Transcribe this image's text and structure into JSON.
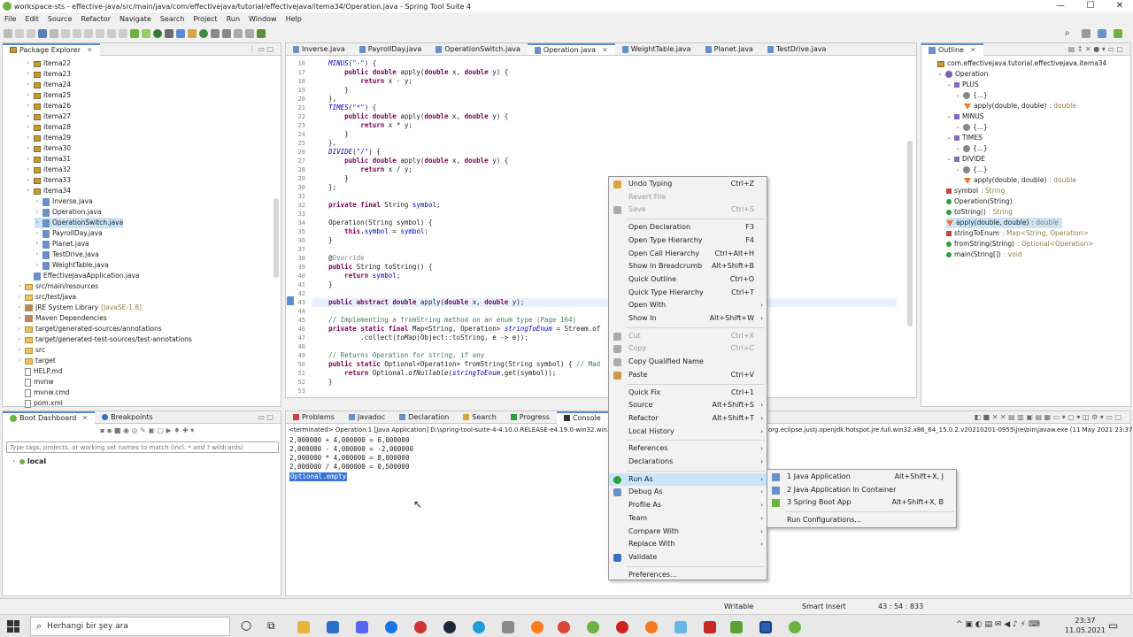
{
  "window": {
    "title": "workspace-sts - effective-java/src/main/java/com/effectivejava/tutorial/effectivejava/itema34/Operation.java - Spring Tool Suite 4",
    "minimize": "—",
    "maximize": "☐",
    "close": "✕"
  },
  "menubar": [
    "File",
    "Edit",
    "Source",
    "Refactor",
    "Navigate",
    "Search",
    "Project",
    "Run",
    "Window",
    "Help"
  ],
  "package_explorer": {
    "tab": "Package Explorer",
    "items": [
      {
        "label": "itema22",
        "type": "pkg",
        "indent": 2
      },
      {
        "label": "itema23",
        "type": "pkg",
        "indent": 2
      },
      {
        "label": "itema24",
        "type": "pkg",
        "indent": 2
      },
      {
        "label": "itema25",
        "type": "pkg",
        "indent": 2
      },
      {
        "label": "itema26",
        "type": "pkg",
        "indent": 2
      },
      {
        "label": "itema27",
        "type": "pkg",
        "indent": 2
      },
      {
        "label": "itema28",
        "type": "pkg",
        "indent": 2
      },
      {
        "label": "itema29",
        "type": "pkg",
        "indent": 2
      },
      {
        "label": "itema30",
        "type": "pkg",
        "indent": 2
      },
      {
        "label": "itema31",
        "type": "pkg",
        "indent": 2
      },
      {
        "label": "itema32",
        "type": "pkg",
        "indent": 2
      },
      {
        "label": "itema33",
        "type": "pkg",
        "indent": 2
      },
      {
        "label": "itema34",
        "type": "pkg",
        "indent": 2
      },
      {
        "label": "Inverse.java",
        "type": "java",
        "indent": 3
      },
      {
        "label": "Operation.java",
        "type": "java",
        "indent": 3
      },
      {
        "label": "OperationSwitch.java",
        "type": "java",
        "indent": 3
      },
      {
        "label": "PayrollDay.java",
        "type": "java",
        "indent": 3
      },
      {
        "label": "Planet.java",
        "type": "java",
        "indent": 3
      },
      {
        "label": "TestDrive.java",
        "type": "java",
        "indent": 3
      },
      {
        "label": "WeightTable.java",
        "type": "java",
        "indent": 3
      },
      {
        "label": "EffectiveJavaApplication.java",
        "type": "java",
        "indent": 2
      },
      {
        "label": "src/main/resources",
        "type": "folder",
        "indent": 1
      },
      {
        "label": "src/test/java",
        "type": "folder",
        "indent": 1
      },
      {
        "label": "JRE System Library",
        "suffix": "[JavaSE-1.8]",
        "type": "lib",
        "indent": 1
      },
      {
        "label": "Maven Dependencies",
        "type": "lib",
        "indent": 1
      },
      {
        "label": "target/generated-sources/annotations",
        "type": "folder",
        "indent": 1
      },
      {
        "label": "target/generated-test-sources/test-annotations",
        "type": "folder",
        "indent": 1
      },
      {
        "label": "src",
        "type": "folder",
        "indent": 1
      },
      {
        "label": "target",
        "type": "folder",
        "indent": 1
      },
      {
        "label": "HELP.md",
        "type": "file",
        "indent": 1
      },
      {
        "label": "mvnw",
        "type": "file",
        "indent": 1
      },
      {
        "label": "mvnw.cmd",
        "type": "file",
        "indent": 1
      },
      {
        "label": "pom.xml",
        "type": "file",
        "indent": 1
      }
    ]
  },
  "editor_tabs": [
    "Inverse.java",
    "PayrollDay.java",
    "OperationSwitch.java",
    "Operation.java",
    "WeightTable.java",
    "Planet.java",
    "TestDrive.java"
  ],
  "code_lines": [
    {
      "n": "16",
      "t": "    MINUS(\"-\") {"
    },
    {
      "n": "17",
      "t": "        public double apply(double x, double y) {"
    },
    {
      "n": "18",
      "t": "            return x - y;"
    },
    {
      "n": "19",
      "t": "        }"
    },
    {
      "n": "20",
      "t": "    },"
    },
    {
      "n": "21",
      "t": "    TIMES(\"*\") {"
    },
    {
      "n": "22",
      "t": "        public double apply(double x, double y) {"
    },
    {
      "n": "23",
      "t": "            return x * y;"
    },
    {
      "n": "24",
      "t": "        }"
    },
    {
      "n": "25",
      "t": "    },"
    },
    {
      "n": "26",
      "t": "    DIVIDE(\"/\") {"
    },
    {
      "n": "27",
      "t": "        public double apply(double x, double y) {"
    },
    {
      "n": "28",
      "t": "            return x / y;"
    },
    {
      "n": "29",
      "t": "        }"
    },
    {
      "n": "30",
      "t": "    };"
    },
    {
      "n": "31",
      "t": ""
    },
    {
      "n": "32",
      "t": "    private final String symbol;"
    },
    {
      "n": "33",
      "t": ""
    },
    {
      "n": "34",
      "t": "    Operation(String symbol) {"
    },
    {
      "n": "35",
      "t": "        this.symbol = symbol;"
    },
    {
      "n": "36",
      "t": "    }"
    },
    {
      "n": "37",
      "t": ""
    },
    {
      "n": "38",
      "t": "    @Override"
    },
    {
      "n": "39",
      "t": "    public String toString() {"
    },
    {
      "n": "40",
      "t": "        return symbol;"
    },
    {
      "n": "41",
      "t": "    }"
    },
    {
      "n": "42",
      "t": ""
    },
    {
      "n": "43",
      "t": "    public abstract double apply(double x, double y);"
    },
    {
      "n": "44",
      "t": ""
    },
    {
      "n": "45",
      "t": "    // Implementing a fromString method on an enum type (Page 164)"
    },
    {
      "n": "46",
      "t": "    private static final Map<String, Operation> stringToEnum = Stream.of"
    },
    {
      "n": "47",
      "t": "            .collect(toMap(Object::toString, e -> e));"
    },
    {
      "n": "48",
      "t": ""
    },
    {
      "n": "49",
      "t": "    // Returns Operation for string, if any"
    },
    {
      "n": "50",
      "t": "    public static Optional<Operation> fromString(String symbol) { // Mad"
    },
    {
      "n": "51",
      "t": "        return Optional.ofNullable(stringToEnum.get(symbol));"
    },
    {
      "n": "52",
      "t": "    }"
    },
    {
      "n": "53",
      "t": ""
    }
  ],
  "outline": {
    "tab": "Outline",
    "items": [
      {
        "label": "com.effectivejava.tutorial.effectivejava.itema34",
        "indent": 1
      },
      {
        "label": "Operation",
        "indent": 1
      },
      {
        "label": "PLUS",
        "indent": 2
      },
      {
        "label": "{...}",
        "indent": 3
      },
      {
        "label": "apply(double, double)",
        "suffix": ": double",
        "indent": 4
      },
      {
        "label": "MINUS",
        "indent": 2
      },
      {
        "label": "{...}",
        "indent": 3
      },
      {
        "label": "TIMES",
        "indent": 2
      },
      {
        "label": "{...}",
        "indent": 3
      },
      {
        "label": "DIVIDE",
        "indent": 2
      },
      {
        "label": "{...}",
        "indent": 3
      },
      {
        "label": "apply(double, double)",
        "suffix": ": double",
        "indent": 4
      },
      {
        "label": "symbol",
        "suffix": ": String",
        "indent": 2
      },
      {
        "label": "Operation(String)",
        "indent": 2
      },
      {
        "label": "toString()",
        "suffix": ": String",
        "indent": 2
      },
      {
        "label": "apply(double, double)",
        "suffix": ": double",
        "indent": 2,
        "selected": true
      },
      {
        "label": "stringToEnum",
        "suffix": ": Map<String, Operation>",
        "indent": 2
      },
      {
        "label": "fromString(String)",
        "suffix": ": Optional<Operation>",
        "indent": 2
      },
      {
        "label": "main(String[])",
        "suffix": ": void",
        "indent": 2
      }
    ]
  },
  "boot_dashboard": {
    "tabs": [
      "Boot Dashboard",
      "Breakpoints"
    ],
    "filter_placeholder": "Type tags, projects, or working set names to match (incl. * and ? wildcards)",
    "local": "local"
  },
  "console": {
    "tabs": [
      "Problems",
      "Javadoc",
      "Declaration",
      "Search",
      "Progress",
      "Console",
      "Debug"
    ],
    "header_left": "<terminated> Operation.1 [Java Application] D:\\spring-tool-suite-4-4.10.0.RELEASE-e4.19.0-win32.win3",
    "header_right": "org.eclipse.justj.openjdk.hotspot.jre.full.win32.x86_64_15.0.2.v20210201-0955\\jre\\bin\\javaw.exe  (11 May 2021 23:37:1",
    "lines": [
      "2,000000 + 4,000000 = 6,000000",
      "2,000000 - 4,000000 = -2,000000",
      "2,000000 * 4,000000 = 8,000000",
      "2,000000 / 4,000000 = 0,500000"
    ],
    "selected_line": "Optional.empty"
  },
  "context_menu": {
    "items": [
      {
        "label": "Undo Typing",
        "shortcut": "Ctrl+Z",
        "icon": "undo-icon"
      },
      {
        "label": "Revert File",
        "shortcut": "",
        "disabled": true
      },
      {
        "label": "Save",
        "shortcut": "Ctrl+S",
        "disabled": true,
        "icon": "save-icon"
      },
      {
        "sep": true
      },
      {
        "label": "Open Declaration",
        "shortcut": "F3"
      },
      {
        "label": "Open Type Hierarchy",
        "shortcut": "F4"
      },
      {
        "label": "Open Call Hierarchy",
        "shortcut": "Ctrl+Alt+H"
      },
      {
        "label": "Show in Breadcrumb",
        "shortcut": "Alt+Shift+B"
      },
      {
        "label": "Quick Outline",
        "shortcut": "Ctrl+O"
      },
      {
        "label": "Quick Type Hierarchy",
        "shortcut": "Ctrl+T"
      },
      {
        "label": "Open With",
        "shortcut": "",
        "submenu": true
      },
      {
        "label": "Show In",
        "shortcut": "Alt+Shift+W",
        "submenu": true
      },
      {
        "sep": true
      },
      {
        "label": "Cut",
        "shortcut": "Ctrl+X",
        "disabled": true,
        "icon": "cut-icon"
      },
      {
        "label": "Copy",
        "shortcut": "Ctrl+C",
        "disabled": true,
        "icon": "copy-icon"
      },
      {
        "label": "Copy Qualified Name",
        "shortcut": "",
        "icon": "copy-icon"
      },
      {
        "label": "Paste",
        "shortcut": "Ctrl+V",
        "icon": "paste-icon"
      },
      {
        "sep": true
      },
      {
        "label": "Quick Fix",
        "shortcut": "Ctrl+1"
      },
      {
        "label": "Source",
        "shortcut": "Alt+Shift+S",
        "submenu": true
      },
      {
        "label": "Refactor",
        "shortcut": "Alt+Shift+T",
        "submenu": true
      },
      {
        "label": "Local History",
        "shortcut": "",
        "submenu": true
      },
      {
        "sep": true
      },
      {
        "label": "References",
        "shortcut": "",
        "submenu": true
      },
      {
        "label": "Declarations",
        "shortcut": "",
        "submenu": true
      },
      {
        "sep": true
      },
      {
        "label": "Run As",
        "shortcut": "",
        "submenu": true,
        "highlight": true,
        "icon": "run-icon"
      },
      {
        "label": "Debug As",
        "shortcut": "",
        "submenu": true,
        "icon": "debug-icon"
      },
      {
        "label": "Profile As",
        "shortcut": "",
        "submenu": true
      },
      {
        "label": "Team",
        "shortcut": "",
        "submenu": true
      },
      {
        "label": "Compare With",
        "shortcut": "",
        "submenu": true
      },
      {
        "label": "Replace With",
        "shortcut": "",
        "submenu": true
      },
      {
        "label": "Validate",
        "shortcut": "",
        "icon": "check-icon"
      },
      {
        "sep": true
      },
      {
        "label": "Preferences...",
        "shortcut": ""
      }
    ]
  },
  "run_as_submenu": {
    "items": [
      {
        "label": "1 Java Application",
        "shortcut": "Alt+Shift+X, J"
      },
      {
        "label": "2 Java Application In Container",
        "shortcut": ""
      },
      {
        "label": "3 Spring Boot App",
        "shortcut": "Alt+Shift+X, B"
      },
      {
        "sep": true
      },
      {
        "label": "Run Configurations...",
        "shortcut": ""
      }
    ]
  },
  "status": {
    "writable": "Writable",
    "insert": "Smart Insert",
    "position": "43 : 54 : 833"
  },
  "taskbar": {
    "search_placeholder": "Herhangi bir şey ara",
    "time": "23:37",
    "date": "11.05.2021"
  }
}
